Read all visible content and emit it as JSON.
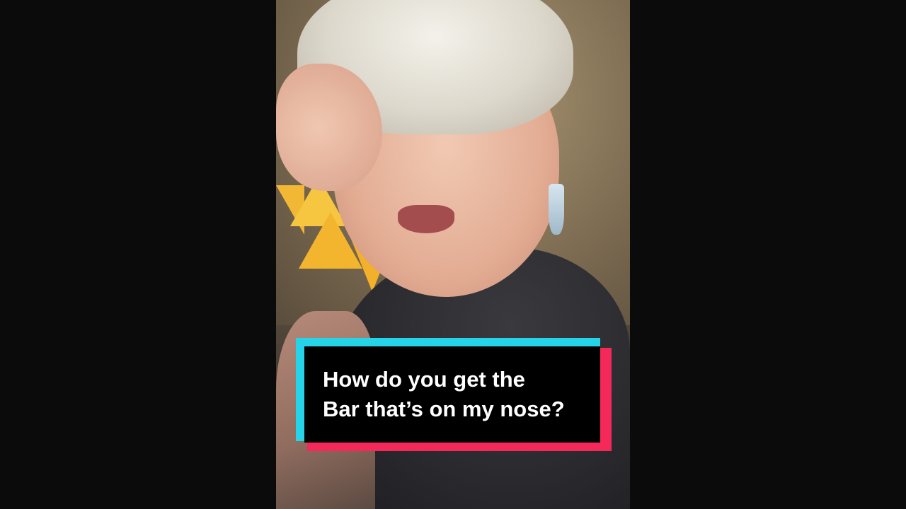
{
  "caption": {
    "line1": "How do you get the",
    "line2": "Bar that’s on my nose?"
  },
  "colors": {
    "background": "#0b0b0b",
    "caption_box": "#000000",
    "caption_text": "#ffffff",
    "accent_cyan": "#25d4e8",
    "accent_red": "#f5285a"
  }
}
